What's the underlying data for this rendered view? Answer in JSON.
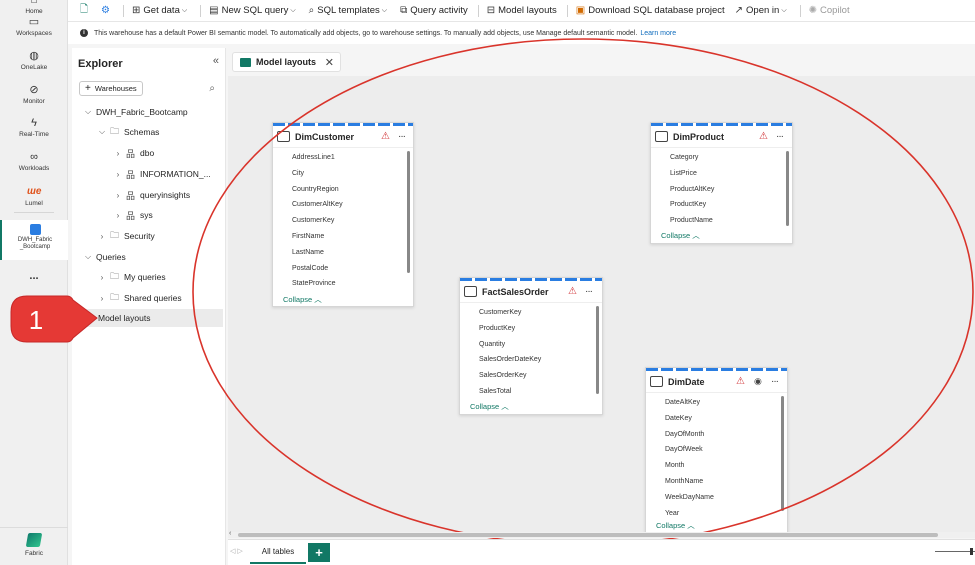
{
  "rail": {
    "items": [
      {
        "label": "Home",
        "icon": "home-icon"
      },
      {
        "label": "Workspaces",
        "icon": "workspaces-icon"
      },
      {
        "label": "OneLake",
        "icon": "onelake-icon"
      },
      {
        "label": "Monitor",
        "icon": "monitor-icon"
      },
      {
        "label": "Real-Time",
        "icon": "real-time-icon"
      },
      {
        "label": "Workloads",
        "icon": "workloads-icon"
      },
      {
        "label": "Lumel",
        "icon": "lumel-icon"
      },
      {
        "label": "DWH_Fabric_Bootcamp",
        "icon": "warehouse-icon"
      }
    ],
    "more": "...",
    "fabric_label": "Fabric"
  },
  "toolbar": {
    "get_data": "Get data",
    "new_sql_query": "New SQL query",
    "sql_templates": "SQL templates",
    "query_activity": "Query activity",
    "model_layouts": "Model layouts",
    "download_project": "Download SQL database project",
    "open_in": "Open in",
    "copilot": "Copilot"
  },
  "infobar": {
    "message": "This warehouse has a default Power BI semantic model. To automatically add objects, go to warehouse settings. To manually add objects, use Manage default semantic model.",
    "learn_more": "Learn more"
  },
  "explorer": {
    "title": "Explorer",
    "add_warehouses": "Warehouses",
    "tree": {
      "warehouse": "DWH_Fabric_Bootcamp",
      "schemas": "Schemas",
      "dbo": "dbo",
      "information": "INFORMATION_...",
      "queryinsights": "queryinsights",
      "sys": "sys",
      "security": "Security",
      "queries": "Queries",
      "my_queries": "My queries",
      "shared_queries": "Shared queries",
      "model_layouts": "Model layouts"
    }
  },
  "callout": {
    "number": "1"
  },
  "canvas": {
    "tab_label": "Model layouts",
    "tables": {
      "dimcustomer": {
        "name": "DimCustomer",
        "columns": [
          "AddressLine1",
          "City",
          "CountryRegion",
          "CustomerAltKey",
          "CustomerKey",
          "FirstName",
          "LastName",
          "PostalCode",
          "StateProvince"
        ],
        "collapse": "Collapse"
      },
      "dimproduct": {
        "name": "DimProduct",
        "columns": [
          "Category",
          "ListPrice",
          "ProductAltKey",
          "ProductKey",
          "ProductName"
        ],
        "collapse": "Collapse"
      },
      "factsalesorder": {
        "name": "FactSalesOrder",
        "columns": [
          "CustomerKey",
          "ProductKey",
          "Quantity",
          "SalesOrderDateKey",
          "SalesOrderKey",
          "SalesTotal"
        ],
        "collapse": "Collapse"
      },
      "dimdate": {
        "name": "DimDate",
        "columns": [
          "DateAltKey",
          "DateKey",
          "DayOfMonth",
          "DayOfWeek",
          "Month",
          "MonthName",
          "WeekDayName",
          "Year"
        ],
        "collapse": "Collapse"
      }
    }
  },
  "bottombar": {
    "all_tables": "All tables",
    "add": "+"
  },
  "colors": {
    "accent": "#117865",
    "oval": "#d9342b",
    "callout": "#e53935",
    "header_stripe": "#2a7de1",
    "warning": "#d13438"
  }
}
